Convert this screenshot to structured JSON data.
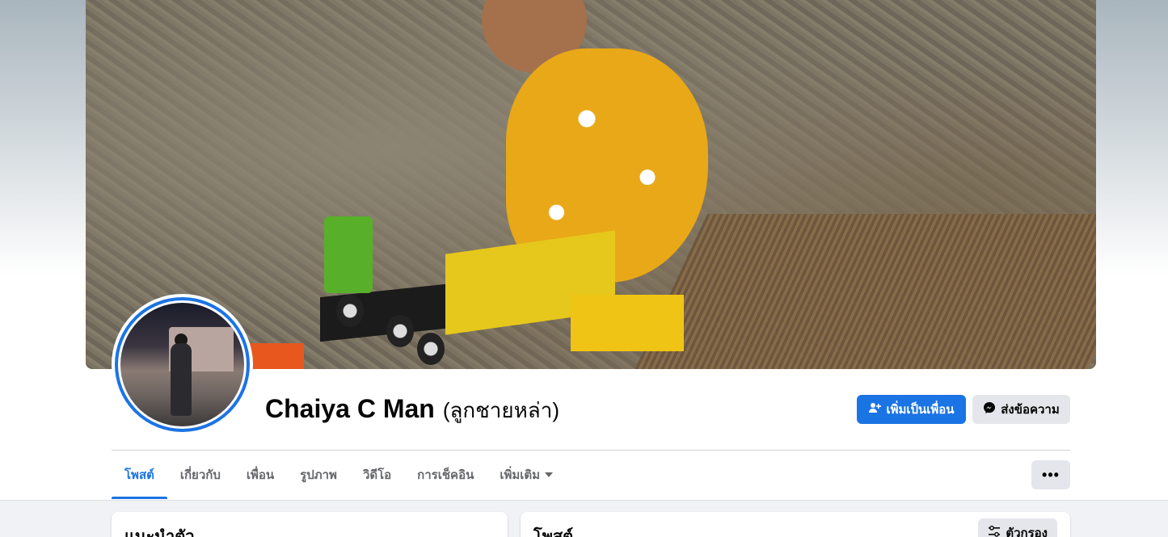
{
  "profile": {
    "name": "Chaiya C Man",
    "alternate_name": "(ลูกชายหล่า)"
  },
  "actions": {
    "add_friend_label": "เพิ่มเป็นเพื่อน",
    "message_label": "ส่งข้อความ",
    "more_label": "•••"
  },
  "tabs": [
    {
      "label": "โพสต์",
      "active": true
    },
    {
      "label": "เกี่ยวกับ",
      "active": false
    },
    {
      "label": "เพื่อน",
      "active": false
    },
    {
      "label": "รูปภาพ",
      "active": false
    },
    {
      "label": "วิดีโอ",
      "active": false
    },
    {
      "label": "การเช็คอิน",
      "active": false
    },
    {
      "label": "เพิ่มเติม",
      "active": false,
      "has_dropdown": true
    }
  ],
  "intro_card": {
    "title": "แนะนำตัว"
  },
  "posts_card": {
    "title": "โพสต์",
    "filter_label": "ตัวกรอง"
  },
  "colors": {
    "accent": "#1b74e4",
    "button_secondary": "#e4e6eb",
    "feed_background": "#f0f2f5"
  },
  "icons": {
    "add_friend": "person-plus-icon",
    "message": "messenger-icon",
    "filter": "sliders-icon",
    "dropdown": "caret-down-icon"
  }
}
